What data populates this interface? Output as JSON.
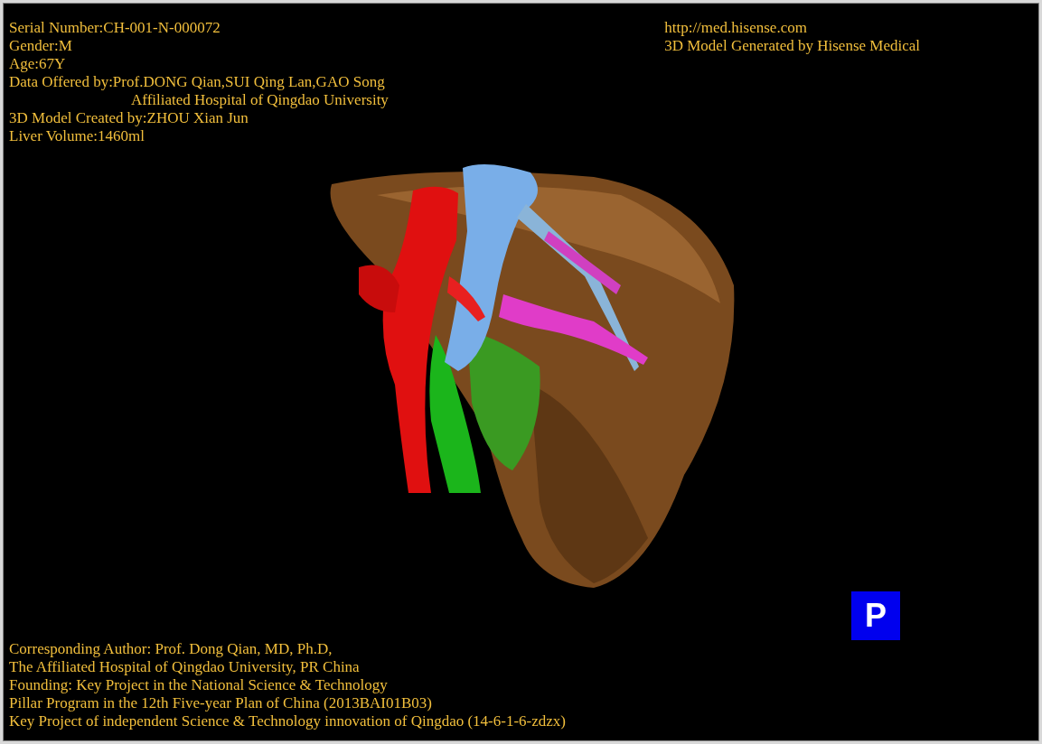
{
  "info_top_left": [
    {
      "text": "Serial Number:CH-001-N-000072",
      "continuation": false
    },
    {
      "text": "Gender:M",
      "continuation": false
    },
    {
      "text": "Age:67Y",
      "continuation": false
    },
    {
      "text": "Data Offered by:Prof.DONG Qian,SUI Qing Lan,GAO Song",
      "continuation": false
    },
    {
      "text": "Affiliated Hospital of Qingdao University",
      "continuation": true
    },
    {
      "text": "3D Model Created by:ZHOU Xian Jun",
      "continuation": false
    },
    {
      "text": "Liver Volume:1460ml",
      "continuation": false
    }
  ],
  "info_top_right": [
    "http://med.hisense.com",
    "3D Model Generated by Hisense Medical"
  ],
  "view_badge": "P",
  "info_bottom_left": [
    "Corresponding Author: Prof. Dong Qian, MD, Ph.D,",
    "The Affiliated Hospital of Qingdao University, PR China",
    "Founding: Key Project in the National Science & Technology",
    "Pillar Program in the 12th Five-year Plan of China (2013BAI01B03)",
    "Key Project of independent Science & Technology innovation of Qingdao (14-6-1-6-zdzx)"
  ]
}
